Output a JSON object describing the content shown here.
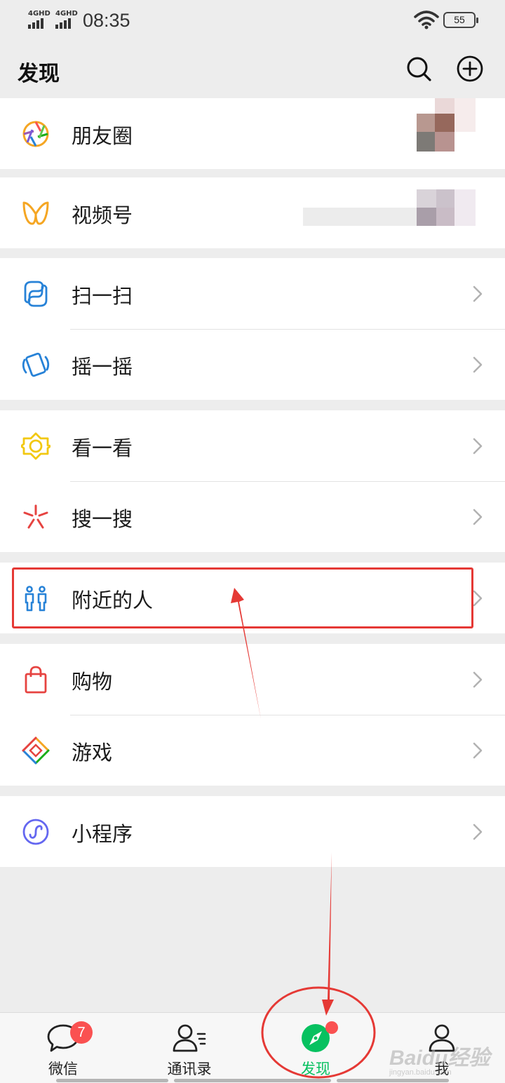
{
  "status_bar": {
    "signal_1": "4GHD",
    "signal_2": "4GHD",
    "time": "08:35",
    "battery": "55"
  },
  "header": {
    "title": "发现",
    "search_icon": "search-icon",
    "add_icon": "plus-circle-icon"
  },
  "menu": {
    "moments": {
      "label": "朋友圈",
      "icon": "moments-aperture-icon"
    },
    "channels": {
      "label": "视频号",
      "icon": "channels-butterfly-icon"
    },
    "scan": {
      "label": "扫一扫",
      "icon": "scan-icon"
    },
    "shake": {
      "label": "摇一摇",
      "icon": "shake-icon"
    },
    "top_stories": {
      "label": "看一看",
      "icon": "top-stories-icon"
    },
    "search": {
      "label": "搜一搜",
      "icon": "search-star-icon"
    },
    "nearby": {
      "label": "附近的人",
      "icon": "people-nearby-icon"
    },
    "shopping": {
      "label": "购物",
      "icon": "shopping-bag-icon"
    },
    "games": {
      "label": "游戏",
      "icon": "games-diamond-icon"
    },
    "mini_programs": {
      "label": "小程序",
      "icon": "mini-program-icon"
    }
  },
  "tabbar": {
    "chats": {
      "label": "微信",
      "badge": "7",
      "icon": "chat-bubble-icon"
    },
    "contacts": {
      "label": "通讯录",
      "icon": "contacts-icon"
    },
    "discover": {
      "label": "发现",
      "icon": "compass-icon"
    },
    "me": {
      "label": "我",
      "icon": "person-icon"
    }
  },
  "watermark": {
    "brand": "Baidu经验",
    "url": "jingyan.baidu.com"
  },
  "colors": {
    "accent_green": "#07c160",
    "annotation_red": "#e53935",
    "badge_red": "#fa5151",
    "page_bg": "#ededed"
  }
}
